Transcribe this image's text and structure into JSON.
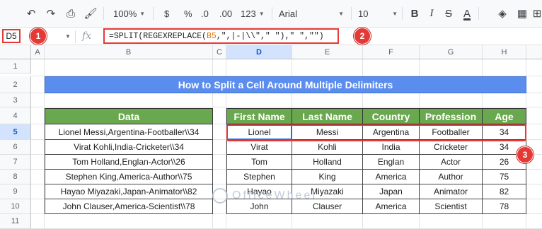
{
  "toolbar": {
    "zoom": "100%",
    "currency": "$",
    "percent": "%",
    "decrease_decimal": ".0",
    "increase_decimal": ".00",
    "number_format": "123",
    "font": "Arial",
    "font_size": "10",
    "bold": "B",
    "italic": "I",
    "text_color": "A"
  },
  "formula_bar": {
    "cell_ref": "D5",
    "fx": "fx",
    "formula_prefix": "=SPLIT(REGEXREPLACE(",
    "formula_ref": "B5",
    "formula_suffix": ",\",|-|\\\\\",\" \"),\" \",\"\")"
  },
  "badges": [
    "1",
    "2",
    "3"
  ],
  "columns": [
    "A",
    "B",
    "C",
    "D",
    "E",
    "F",
    "G",
    "H"
  ],
  "rows": [
    "1",
    "2",
    "3",
    "4",
    "5",
    "6",
    "7",
    "8",
    "9",
    "10",
    "11"
  ],
  "title": "How to Split a Cell Around Multiple Delimiters",
  "data_table": {
    "header": "Data",
    "rows": [
      "Lionel Messi,Argentina-Footballer\\\\34",
      "Virat Kohli,India-Cricketer\\\\34",
      "Tom Holland,Englan-Actor\\\\26",
      "Stephen King,America-Author\\\\75",
      "Hayao Miyazaki,Japan-Animator\\\\82",
      "John Clauser,America-Scientist\\\\78"
    ]
  },
  "result_table": {
    "headers": [
      "First Name",
      "Last Name",
      "Country",
      "Profession",
      "Age"
    ],
    "rows": [
      [
        "Lionel",
        "Messi",
        "Argentina",
        "Footballer",
        "34"
      ],
      [
        "Virat",
        "Kohli",
        "India",
        "Cricketer",
        "34"
      ],
      [
        "Tom",
        "Holland",
        "Englan",
        "Actor",
        "26"
      ],
      [
        "Stephen",
        "King",
        "America",
        "Author",
        "75"
      ],
      [
        "Hayao",
        "Miyazaki",
        "Japan",
        "Animator",
        "82"
      ],
      [
        "John",
        "Clauser",
        "America",
        "Scientist",
        "78"
      ]
    ]
  },
  "watermark": "OfficeWheel",
  "colors": {
    "title_bg": "#5b8def",
    "header_bg": "#6aa84f",
    "highlight": "#e53935",
    "selection": "#1a73e8"
  }
}
